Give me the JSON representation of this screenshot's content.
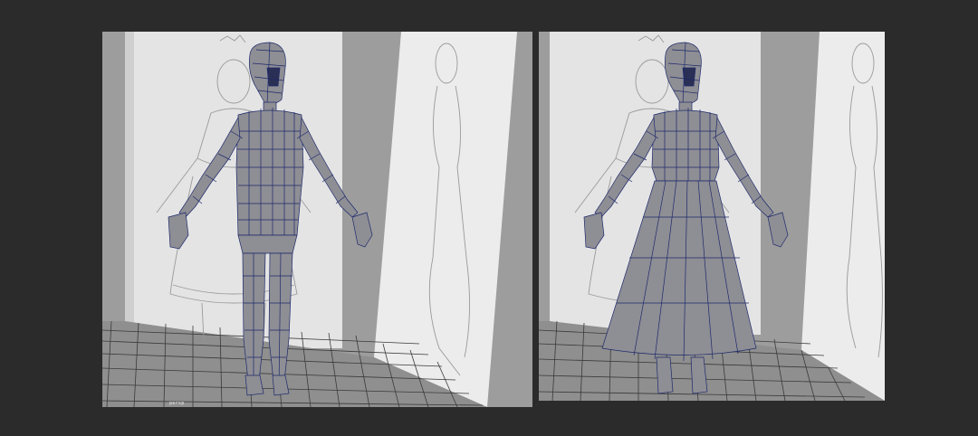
{
  "viewports": [
    {
      "id": "left",
      "hud_label": "persp",
      "model": "body-with-legs"
    },
    {
      "id": "right",
      "hud_label": "",
      "model": "body-with-skirt"
    }
  ],
  "colors": {
    "background": "#2b2b2b",
    "viewport_backdrop": "#9a9a9a",
    "image_plane": "#e6e6e6",
    "floor_grid": "#3a3a3a",
    "mesh_fill": "#8e8e95",
    "mesh_wire": "#1e2a6a",
    "sketch_line": "#8a8a8a"
  }
}
